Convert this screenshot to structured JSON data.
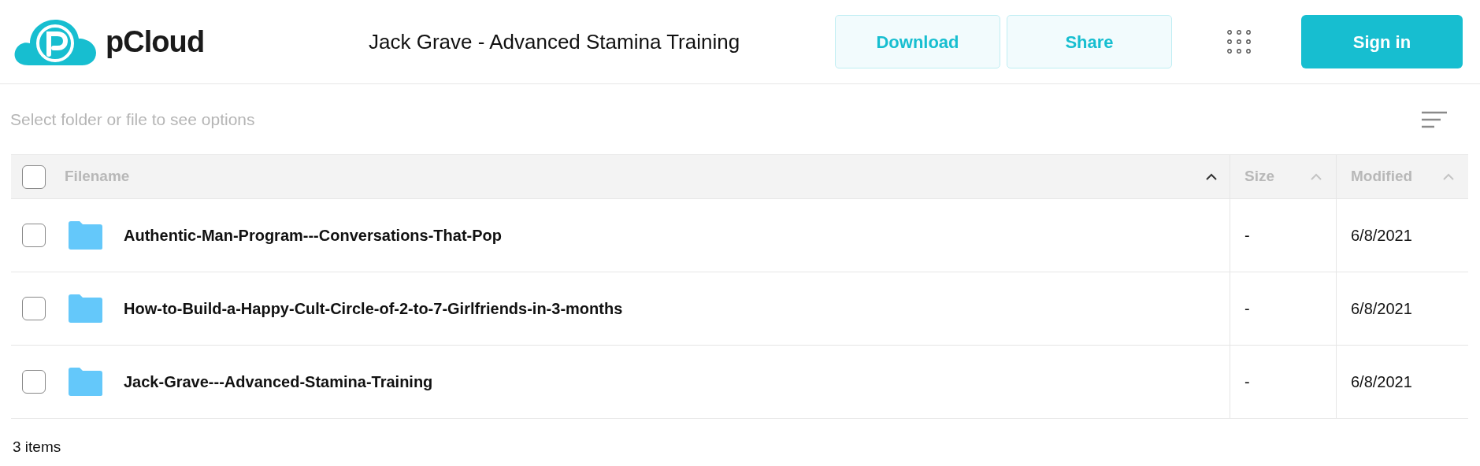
{
  "header": {
    "logo_text": "pCloud",
    "title": "Jack Grave - Advanced Stamina Training",
    "buttons": [
      {
        "label": "Download",
        "kind": "outline"
      },
      {
        "label": "Share",
        "kind": "outline"
      }
    ],
    "sign_in": "Sign in"
  },
  "toolbar": {
    "hint": "Select folder or file to see options"
  },
  "table": {
    "select_all": {
      "checked": false
    },
    "columns": [
      {
        "label": "Filename",
        "sorted": true
      },
      {
        "label": "Size",
        "sorted": false
      },
      {
        "label": "Modified",
        "sorted": false
      }
    ],
    "rows": [
      {
        "name": "Authentic-Man-Program---Conversations-That-Pop",
        "size": "-",
        "modified": "6/8/2021",
        "checked": false
      },
      {
        "name": "How-to-Build-a-Happy-Cult-Circle-of-2-to-7-Girlfriends-in-3-months",
        "size": "-",
        "modified": "6/8/2021",
        "checked": false
      },
      {
        "name": "Jack-Grave---Advanced-Stamina-Training",
        "size": "-",
        "modified": "6/8/2021",
        "checked": false
      }
    ]
  },
  "footer": {
    "count": "3 items"
  }
}
